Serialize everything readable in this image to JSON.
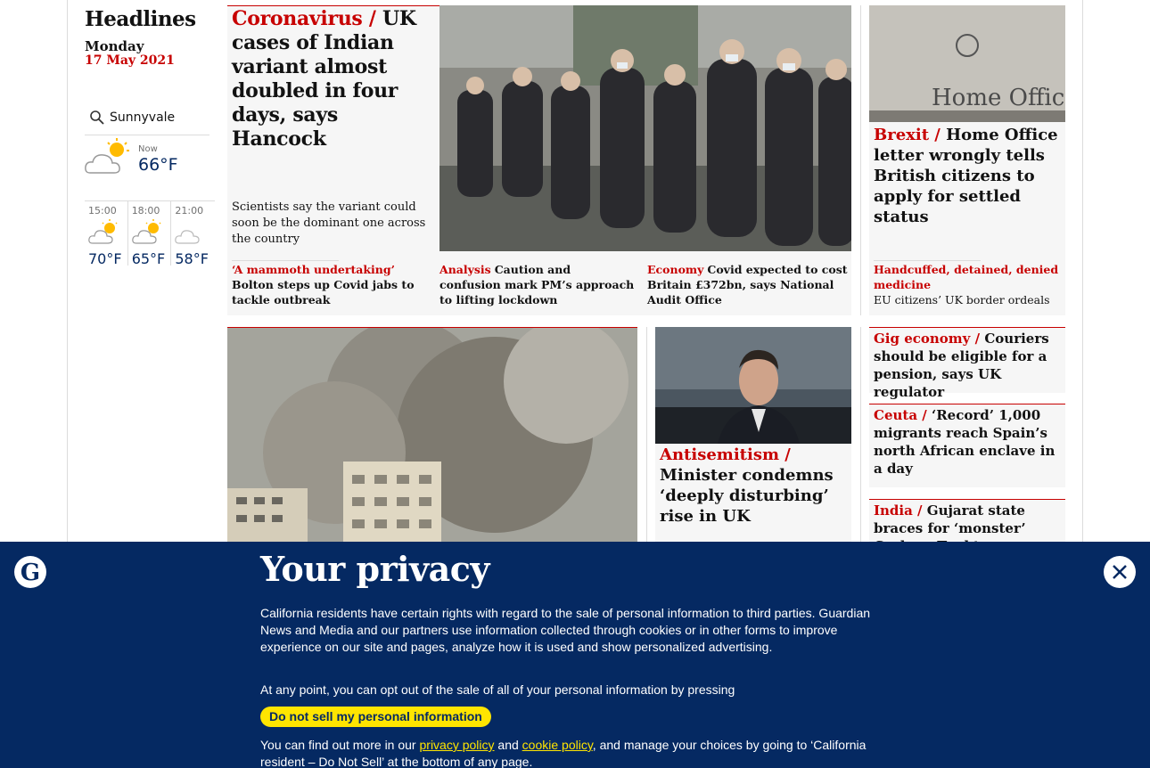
{
  "sidebar": {
    "title": "Headlines",
    "day": "Monday",
    "date": "17 May 2021",
    "location": "Sunnyvale",
    "now_label": "Now",
    "now_temp": "66°F",
    "forecast": [
      {
        "time": "15:00",
        "temp": "70°F",
        "icon": "sun-cloud-icon"
      },
      {
        "time": "18:00",
        "temp": "65°F",
        "icon": "sun-cloud-icon"
      },
      {
        "time": "21:00",
        "temp": "58°F",
        "icon": "moon-cloud-icon"
      }
    ]
  },
  "lead": {
    "kicker": "Coronavirus /",
    "headline": "UK cases of Indian variant almost doubled in four days, says Hancock",
    "standfirst": "Scientists say the variant could soon be the dominant one across the country",
    "sublinks": [
      {
        "kicker": "‘A mammoth undertaking’",
        "headline": "Bolton steps up Covid jabs to tackle outbreak"
      },
      {
        "kicker": "Analysis",
        "headline": "Caution and confusion mark PM’s approach to lifting lockdown"
      },
      {
        "kicker": "Economy",
        "headline": "Covid expected to cost Britain £372bn, says National Audit Office"
      }
    ]
  },
  "homeoffice": {
    "kicker": "Brexit /",
    "headline": "Home Office letter wrongly tells British citizens to apply for settled status",
    "image_sign": "Home Office",
    "sub_kicker": "Handcuffed, detained, denied medicine",
    "sub_headline": "EU citizens’ UK border ordeals"
  },
  "small_stories": [
    {
      "kicker": "Gig economy /",
      "headline": "Couriers should be eligible for a pension, says UK regulator"
    },
    {
      "kicker": "Ceuta /",
      "headline": "‘Record’ 1,000 migrants reach Spain’s north African enclave in a day"
    },
    {
      "kicker": "India /",
      "headline": "Gujarat state braces for ‘monster’ Cyclone Tauktae"
    }
  ],
  "antisemitism": {
    "kicker": "Antisemitism /",
    "headline": "Minister condemns ‘deeply disturbing’ rise in UK"
  },
  "privacy": {
    "title": "Your privacy",
    "p1": "California residents have certain rights with regard to the sale of personal information to third parties. Guardian News and Media and our partners use information collected through cookies or in other forms to improve experience on our site and pages, analyze how it is used and show personalized advertising.",
    "p2": "At any point, you can opt out of the sale of all of your personal information by pressing",
    "button": "Do not sell my personal information",
    "p3_a": "You can find out more in our",
    "link1": "privacy policy",
    "p3_b": "and",
    "link2": "cookie policy",
    "p3_c": ", and manage your choices by going to ‘California resident – Do Not Sell’ at the bottom of any page."
  },
  "colors": {
    "brand": "#052962",
    "accent": "#c70000",
    "button": "#ffe500"
  }
}
